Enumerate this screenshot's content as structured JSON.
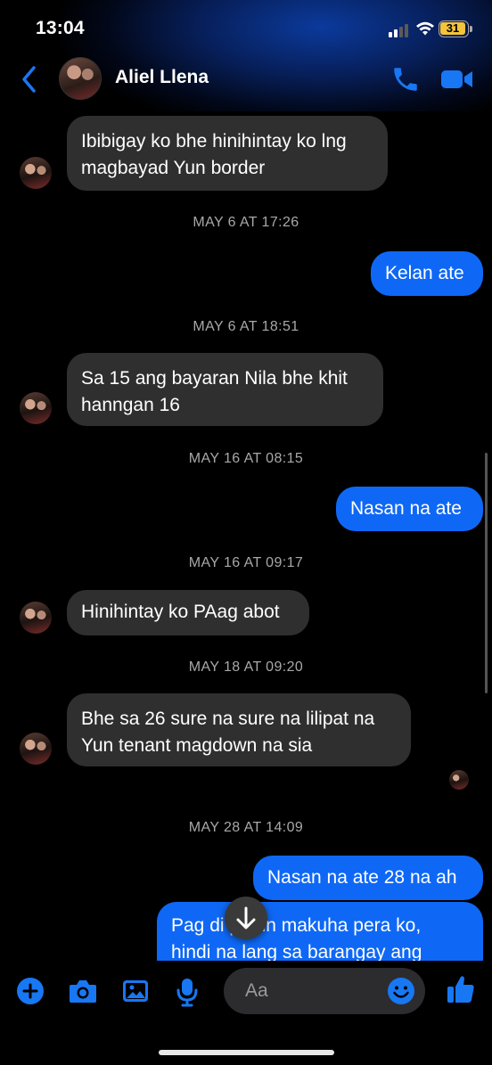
{
  "status": {
    "time": "13:04",
    "battery": "31"
  },
  "header": {
    "contact_name": "Aliel Llena"
  },
  "messages": [
    {
      "side": "in",
      "text": "Ibibigay ko bhe hinihintay ko lng\nmagbayad Yun border"
    },
    {
      "type": "timestamp",
      "text": "MAY 6 AT 17:26"
    },
    {
      "side": "out",
      "text": "Kelan ate"
    },
    {
      "type": "timestamp",
      "text": "MAY 6 AT 18:51"
    },
    {
      "side": "in",
      "text": "Sa 15 ang bayaran Nila bhe khit\nhanngan 16"
    },
    {
      "type": "timestamp",
      "text": "MAY 16 AT 08:15"
    },
    {
      "side": "out",
      "text": "Nasan na ate"
    },
    {
      "type": "timestamp",
      "text": "MAY 16 AT 09:17"
    },
    {
      "side": "in",
      "text": "Hinihintay ko PAag abot"
    },
    {
      "type": "timestamp",
      "text": "MAY 18 AT 09:20"
    },
    {
      "side": "in",
      "text": "Bhe sa 26 sure na sure na lilipat na\nYun tenant magdown na sia"
    },
    {
      "type": "timestamp",
      "text": "MAY 28 AT 14:09"
    },
    {
      "side": "out",
      "text": "Nasan na ate 28 na ah"
    },
    {
      "side": "out",
      "text": "Pag di pa rin makuha pera ko,\nhindi na lang sa barangay ang"
    }
  ],
  "composer": {
    "placeholder": "Aa"
  },
  "colors": {
    "outgoing_bubble": "#0f68f5",
    "incoming_bubble": "#2f2f2f",
    "accent": "#1877f2"
  },
  "icons": [
    "back-icon",
    "phone-icon",
    "video-icon",
    "plus-icon",
    "camera-icon",
    "image-icon",
    "mic-icon",
    "emoji-icon",
    "thumbs-up-icon",
    "arrow-down-icon"
  ]
}
